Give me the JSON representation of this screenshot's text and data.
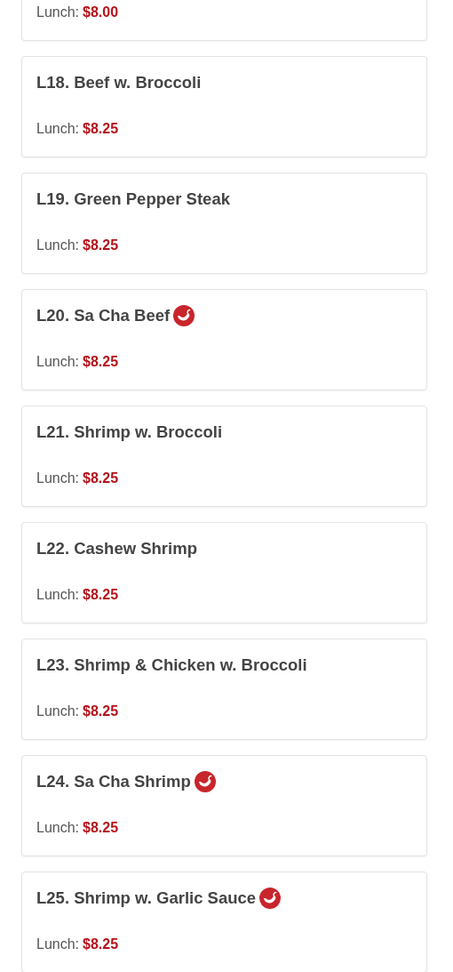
{
  "items": [
    {
      "price_label": "Lunch:",
      "price": "$8.00",
      "spicy": false
    },
    {
      "name": "L18. Beef w. Broccoli",
      "price_label": "Lunch:",
      "price": "$8.25",
      "spicy": false
    },
    {
      "name": "L19. Green Pepper Steak",
      "price_label": "Lunch:",
      "price": "$8.25",
      "spicy": false
    },
    {
      "name": "L20. Sa Cha Beef",
      "price_label": "Lunch:",
      "price": "$8.25",
      "spicy": true
    },
    {
      "name": "L21. Shrimp w. Broccoli",
      "price_label": "Lunch:",
      "price": "$8.25",
      "spicy": false
    },
    {
      "name": "L22. Cashew Shrimp",
      "price_label": "Lunch:",
      "price": "$8.25",
      "spicy": false
    },
    {
      "name": "L23. Shrimp & Chicken w. Broccoli",
      "price_label": "Lunch:",
      "price": "$8.25",
      "spicy": false
    },
    {
      "name": "L24. Sa Cha Shrimp",
      "price_label": "Lunch:",
      "price": "$8.25",
      "spicy": true
    },
    {
      "name": "L25. Shrimp w. Garlic Sauce",
      "price_label": "Lunch:",
      "price": "$8.25",
      "spicy": true
    }
  ]
}
